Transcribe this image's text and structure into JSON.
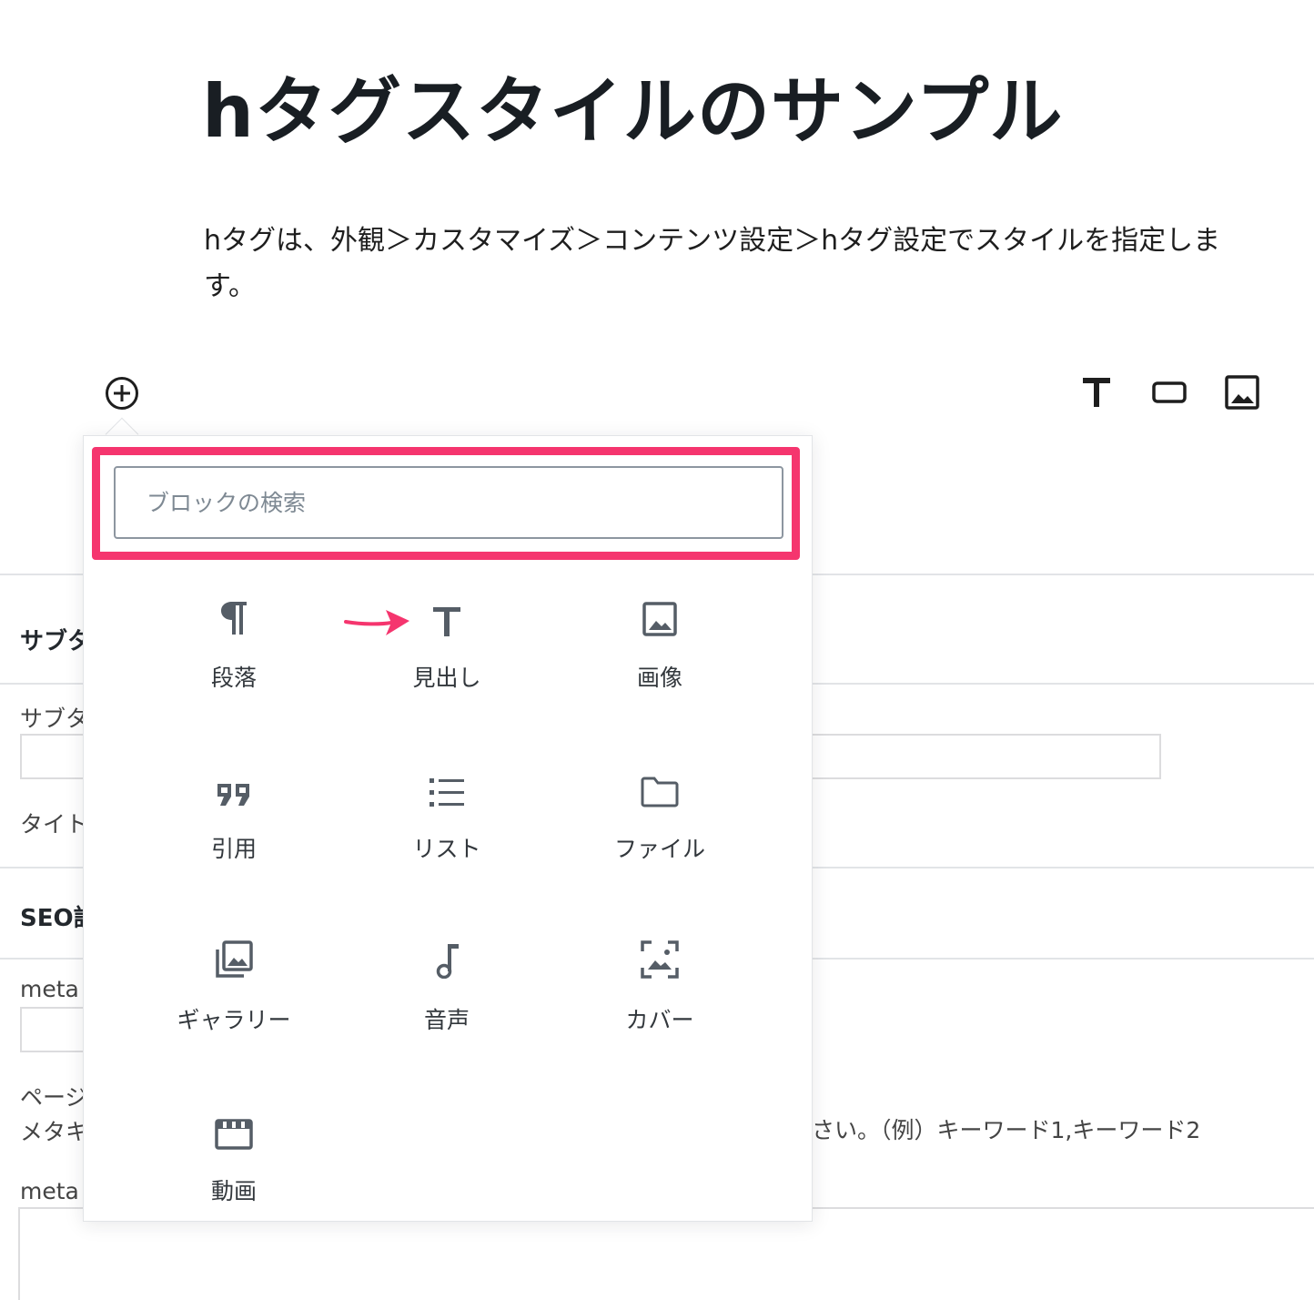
{
  "editor": {
    "title": "hタグスタイルのサンプル",
    "paragraph": "hタグは、外観＞カスタマイズ＞コンテンツ設定＞hタグ設定でスタイルを指定します。"
  },
  "inserter": {
    "search_placeholder": "ブロックの検索",
    "blocks": [
      {
        "label": "段落",
        "icon": "paragraph-icon"
      },
      {
        "label": "見出し",
        "icon": "heading-icon"
      },
      {
        "label": "画像",
        "icon": "image-icon"
      },
      {
        "label": "引用",
        "icon": "quote-icon"
      },
      {
        "label": "リスト",
        "icon": "list-icon"
      },
      {
        "label": "ファイル",
        "icon": "folder-icon"
      },
      {
        "label": "ギャラリー",
        "icon": "gallery-icon"
      },
      {
        "label": "音声",
        "icon": "audio-icon"
      },
      {
        "label": "カバー",
        "icon": "cover-icon"
      },
      {
        "label": "動画",
        "icon": "video-icon"
      }
    ]
  },
  "background": {
    "subtitle_head": "サブタ",
    "subtitle_label": "サブタ",
    "title_label": "タイト",
    "seo_head": "SEO設",
    "meta1_label": "meta",
    "page_label": "ページ",
    "metakey_label": "メタキ",
    "note_text": "さい。（例）キーワード1,キーワード2",
    "meta2_label": "meta"
  },
  "colors": {
    "highlight": "#f5356e",
    "annotation_arrow": "#f5356e"
  }
}
